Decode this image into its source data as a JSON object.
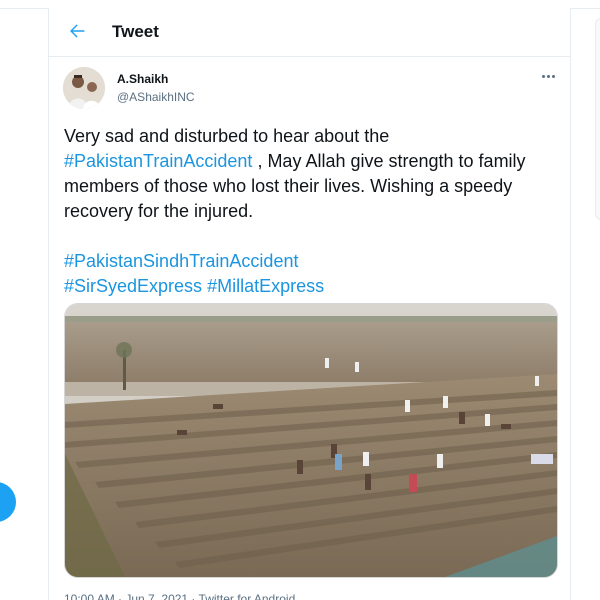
{
  "header": {
    "title": "Tweet",
    "back_icon": "arrow-left-icon"
  },
  "tweet": {
    "author_name": "A.Shaikh",
    "author_handle": "@AShaikhINC",
    "more_icon": "more-horizontal-icon",
    "text_part1": "Very sad and disturbed to hear about the ",
    "hashtag_1": "#PakistanTrainAccident",
    "text_part2": " , May Allah give strength to family members of those who lost their lives. Wishing a speedy recovery for the injured.",
    "hashtag_2": "#PakistanSindhTrainAccident",
    "hashtag_3": "#SirSyedExpress",
    "hashtag_4": "#MillatExpress",
    "meta": "10:00 AM · Jun 7, 2021 · Twitter for Android"
  },
  "colors": {
    "accent": "#1da1f2",
    "hashtag": "#1b95e0",
    "text": "#0f1419",
    "secondary": "#5b7083"
  }
}
